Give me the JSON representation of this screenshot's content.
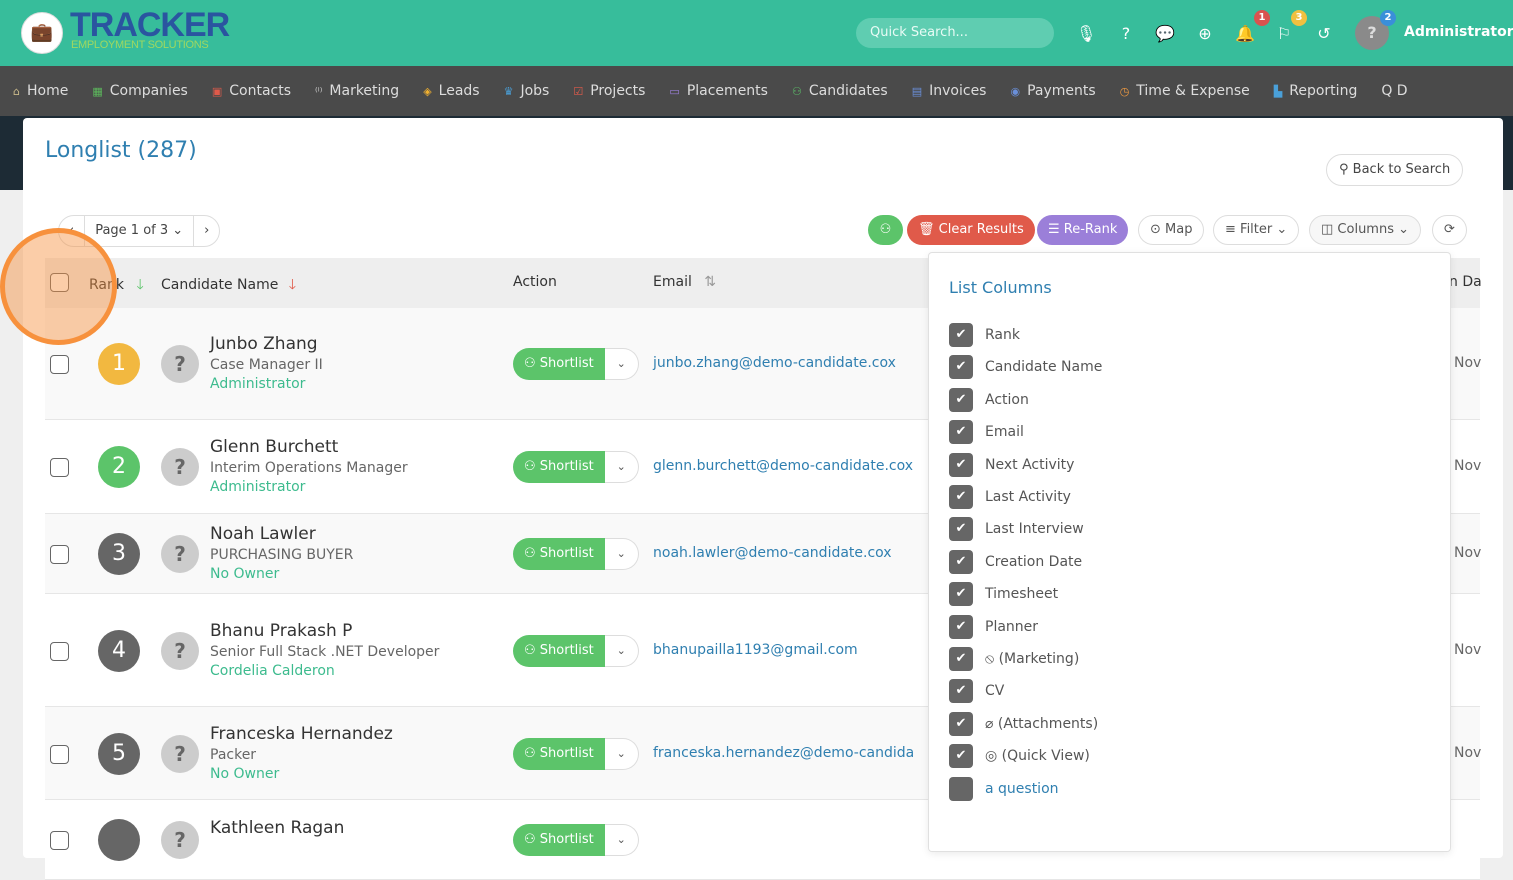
{
  "header": {
    "brand": "TRACKER",
    "brand_sub": "EMPLOYMENT SOLUTIONS",
    "search_placeholder": "Quick Search...",
    "user": "Administrator",
    "badges": {
      "notifications": "1",
      "flags": "3",
      "avatar": "2"
    }
  },
  "nav": [
    "Home",
    "Companies",
    "Contacts",
    "Marketing",
    "Leads",
    "Jobs",
    "Projects",
    "Placements",
    "Candidates",
    "Invoices",
    "Payments",
    "Time & Expense",
    "Reporting",
    "Q D"
  ],
  "page": {
    "title": "Longlist (287)",
    "back": "Back to Search",
    "pager": {
      "prev": "‹",
      "label": "Page 1 of 3 ⌄",
      "next": "›"
    }
  },
  "toolbar": {
    "clear": "Clear Results",
    "rerank": "Re-Rank",
    "map": "Map",
    "filter": "Filter ⌄",
    "columns": "Columns ⌄"
  },
  "table": {
    "headers": {
      "rank": "Rank",
      "name": "Candidate Name",
      "action": "Action",
      "email": "Email",
      "partial": "n Da"
    },
    "rows": [
      {
        "rank": "1",
        "color": "#f2b840",
        "name": "Junbo Zhang",
        "title": "Case Manager II",
        "owner": "Administrator",
        "email": "junbo.zhang@demo-candidate.cox",
        "date": "Nov"
      },
      {
        "rank": "2",
        "color": "#5cc46a",
        "name": "Glenn Burchett",
        "title": "Interim Operations Manager",
        "owner": "Administrator",
        "email": "glenn.burchett@demo-candidate.cox",
        "date": "Nov"
      },
      {
        "rank": "3",
        "color": "#666666",
        "name": "Noah Lawler",
        "title": "PURCHASING BUYER",
        "owner": "No Owner",
        "email": "noah.lawler@demo-candidate.cox",
        "date": "Nov"
      },
      {
        "rank": "4",
        "color": "#666666",
        "name": "Bhanu Prakash P",
        "title": "Senior Full Stack .NET Developer",
        "owner": "Cordelia Calderon",
        "email": "bhanupailla1193@gmail.com",
        "date": "Nov"
      },
      {
        "rank": "5",
        "color": "#666666",
        "name": "Franceska Hernandez",
        "title": "Packer",
        "owner": "No Owner",
        "email": "franceska.hernandez@demo-candida",
        "date": "Nov"
      },
      {
        "rank": "",
        "color": "#666666",
        "name": "Kathleen Ragan",
        "title": "",
        "owner": "",
        "email": "",
        "date": ""
      }
    ],
    "shortlist": "Shortlist"
  },
  "columns_panel": {
    "title": "List Columns",
    "items": [
      {
        "label": "Rank",
        "checked": true
      },
      {
        "label": "Candidate Name",
        "checked": true
      },
      {
        "label": "Action",
        "checked": true
      },
      {
        "label": "Email",
        "checked": true
      },
      {
        "label": "Next Activity",
        "checked": true
      },
      {
        "label": "Last Activity",
        "checked": true
      },
      {
        "label": "Last Interview",
        "checked": true
      },
      {
        "label": "Creation Date",
        "checked": true
      },
      {
        "label": "Timesheet",
        "checked": true
      },
      {
        "label": "Planner",
        "checked": true
      },
      {
        "label": "⦸ (Marketing)",
        "checked": true
      },
      {
        "label": "CV",
        "checked": true
      },
      {
        "label": "⌀ (Attachments)",
        "checked": true
      },
      {
        "label": "◎ (Quick View)",
        "checked": true
      },
      {
        "label": "a question",
        "checked": false
      }
    ]
  }
}
